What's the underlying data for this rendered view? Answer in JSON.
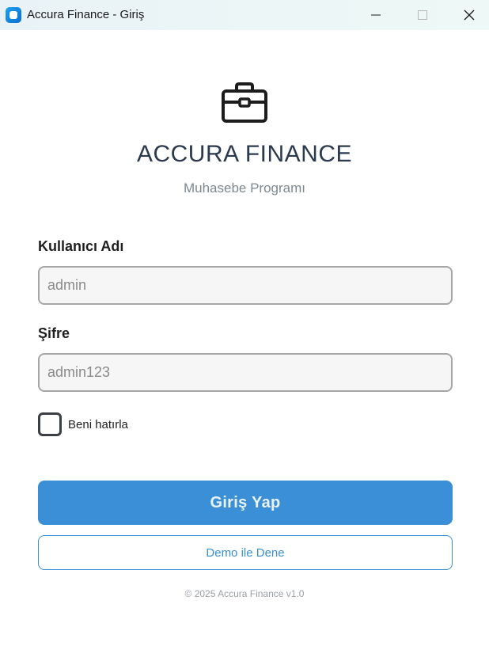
{
  "window": {
    "title": "Accura Finance - Giriş",
    "app_icon": "app-icon",
    "controls": [
      "minimize-icon",
      "maximize-icon",
      "close-icon"
    ]
  },
  "brand": {
    "logo_icon": "briefcase-icon",
    "title": "ACCURA FINANCE",
    "subtitle": "Muhasebe Programı"
  },
  "form": {
    "username_label": "Kullanıcı Adı",
    "username_value": "admin",
    "password_label": "Şifre",
    "password_value": "admin123",
    "remember_label": "Beni hatırla",
    "remember_checked": false,
    "login_button": "Giriş Yap",
    "demo_button": "Demo ile Dene"
  },
  "footer": {
    "text": "© 2025 Accura Finance v1.0"
  },
  "colors": {
    "primary": "#3a8fd6",
    "title": "#2b3a4f",
    "subtitle": "#7d8891"
  }
}
